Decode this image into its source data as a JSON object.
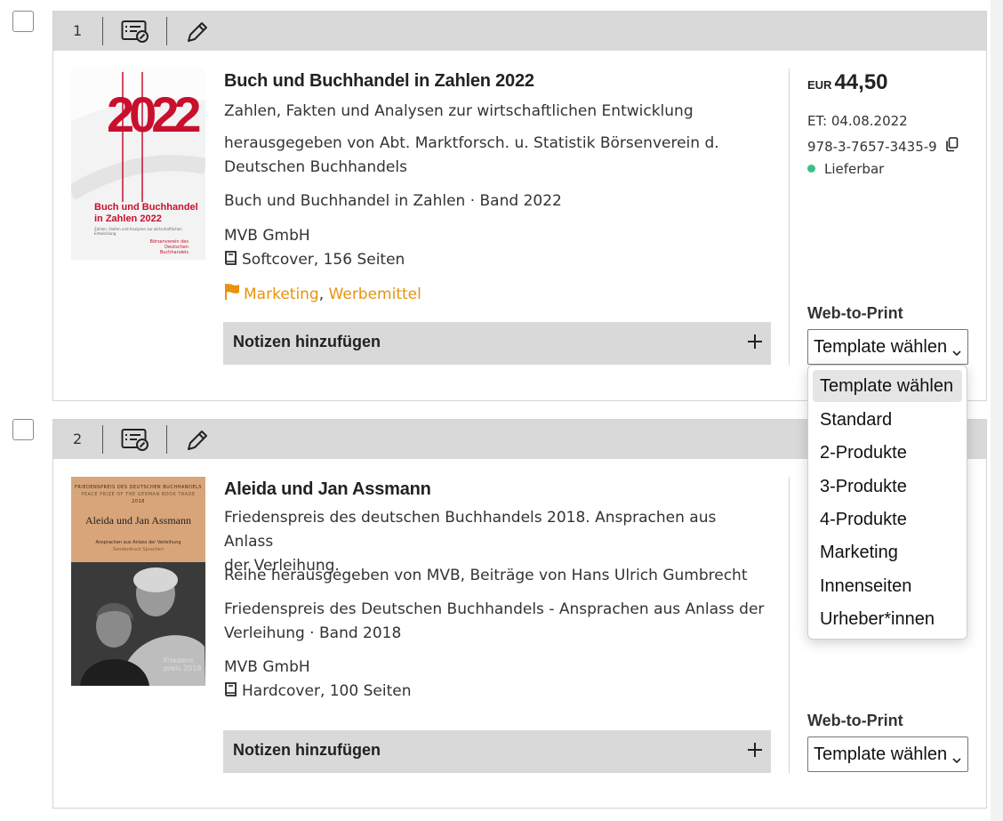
{
  "colors": {
    "accent_orange": "#e8930b",
    "available_green": "#3dbf8a",
    "bar_gray": "#d9d9d9"
  },
  "items": [
    {
      "number": "1",
      "title": "Buch und Buchhandel in Zahlen 2022",
      "subtitle": "Zahlen, Fakten und Analysen zur wirtschaftlichen Entwicklung",
      "editor_line1": "herausgegeben von Abt. Marktforsch. u. Statistik Börsenverein d.",
      "editor_line2": "Deutschen Buchhandels",
      "series": "Buch und Buchhandel in Zahlen · Band 2022",
      "publisher": "MVB GmbH",
      "format": "Softcover, 156 Seiten",
      "tag1": "Marketing",
      "tag_sep": ",",
      "tag2": "Werbemittel",
      "notes_label": "Notizen hinzufügen",
      "currency": "EUR",
      "price": "44,50",
      "release": "ET: 04.08.2022",
      "isbn": "978-3-7657-3435-9",
      "availability": "Lieferbar",
      "wtp_label": "Web-to-Print",
      "template_selected": "Template wählen",
      "cover": {
        "big_year": "2022",
        "title_line1": "Buch und Buchhandel",
        "title_line2": "in Zahlen 2022",
        "tagline": "Zahlen, Fakten und Analysen zur wirtschaftlichen Entwicklung",
        "logo_line1": "Börsenverein des",
        "logo_line2": "Deutschen Buchhandels"
      }
    },
    {
      "number": "2",
      "title": "Aleida und Jan Assmann",
      "subtitle_line1": "Friedenspreis des deutschen Buchhandels 2018. Ansprachen aus Anlass",
      "subtitle_line2": "der Verleihung.",
      "contrib": "Reihe herausgegeben von MVB, Beiträge von Hans Ulrich Gumbrecht",
      "series_line1": "Friedenspreis des Deutschen Buchhandels - Ansprachen aus Anlass der",
      "series_line2": "Verleihung · Band 2018",
      "publisher": "MVB GmbH",
      "format": "Hardcover, 100 Seiten",
      "notes_label": "Notizen hinzufügen",
      "wtp_label": "Web-to-Print",
      "template_selected": "Template wählen",
      "cover": {
        "header1": "FRIEDENSPREIS DES DEUTSCHEN BUCHHANDELS",
        "header2": "PEACE PRIZE OF THE GERMAN BOOK TRADE",
        "year": "2018",
        "names": "Aleida und Jan Assmann",
        "sub1": "Ansprachen aus Anlass der Verleihung",
        "sub2": "Sonderdruck Sprachen",
        "brand1": "Friedens",
        "brand2": "preis 2018"
      }
    }
  ],
  "dropdown_options": [
    "Template wählen",
    "Standard",
    "2-Produkte",
    "3-Produkte",
    "4-Produkte",
    "Marketing",
    "Innenseiten",
    "Urheber*innen"
  ]
}
